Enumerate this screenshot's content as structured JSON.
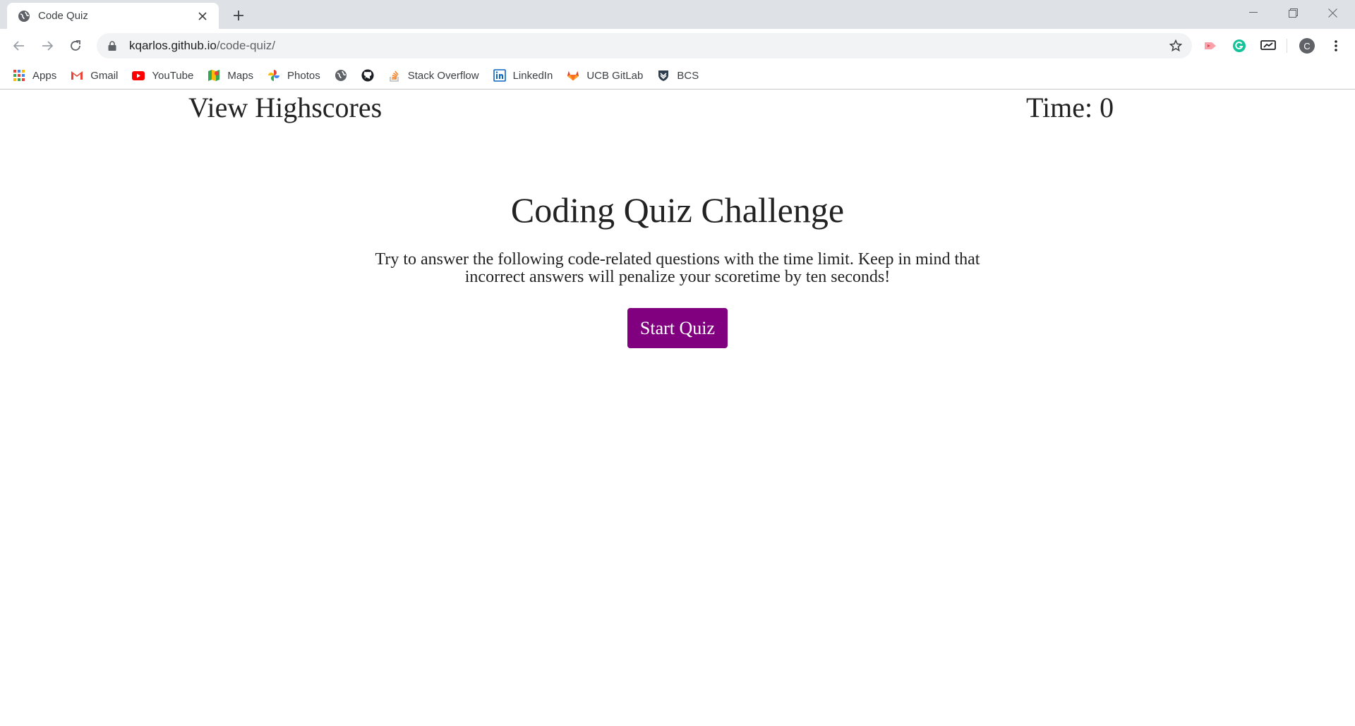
{
  "browser": {
    "tab": {
      "title": "Code Quiz",
      "favicon": "globe-icon"
    },
    "address": {
      "host": "kqarlos.github.io",
      "path": "/code-quiz/"
    },
    "profile_initial": "C",
    "bookmarks": [
      {
        "label": "Apps",
        "icon": "apps-grid-icon"
      },
      {
        "label": "Gmail",
        "icon": "gmail-icon"
      },
      {
        "label": "YouTube",
        "icon": "youtube-icon"
      },
      {
        "label": "Maps",
        "icon": "maps-icon"
      },
      {
        "label": "Photos",
        "icon": "photos-icon"
      },
      {
        "label": "",
        "icon": "globe-icon"
      },
      {
        "label": "",
        "icon": "github-icon"
      },
      {
        "label": "Stack Overflow",
        "icon": "stackoverflow-icon"
      },
      {
        "label": "LinkedIn",
        "icon": "linkedin-icon"
      },
      {
        "label": "UCB GitLab",
        "icon": "gitlab-icon"
      },
      {
        "label": "BCS",
        "icon": "bcs-shield-icon"
      }
    ]
  },
  "page": {
    "highscores_link": "View Highscores",
    "timer_text": "Time: 0",
    "title": "Coding Quiz Challenge",
    "intro": "Try to answer the following code-related questions with the time limit. Keep in mind that incorrect answers will penalize your scoretime by ten seconds!",
    "start_button": "Start Quiz"
  },
  "colors": {
    "button_bg": "#800080",
    "button_text": "#ffffff",
    "tabstrip_bg": "#dee1e6",
    "omnibox_bg": "#f1f3f4"
  }
}
